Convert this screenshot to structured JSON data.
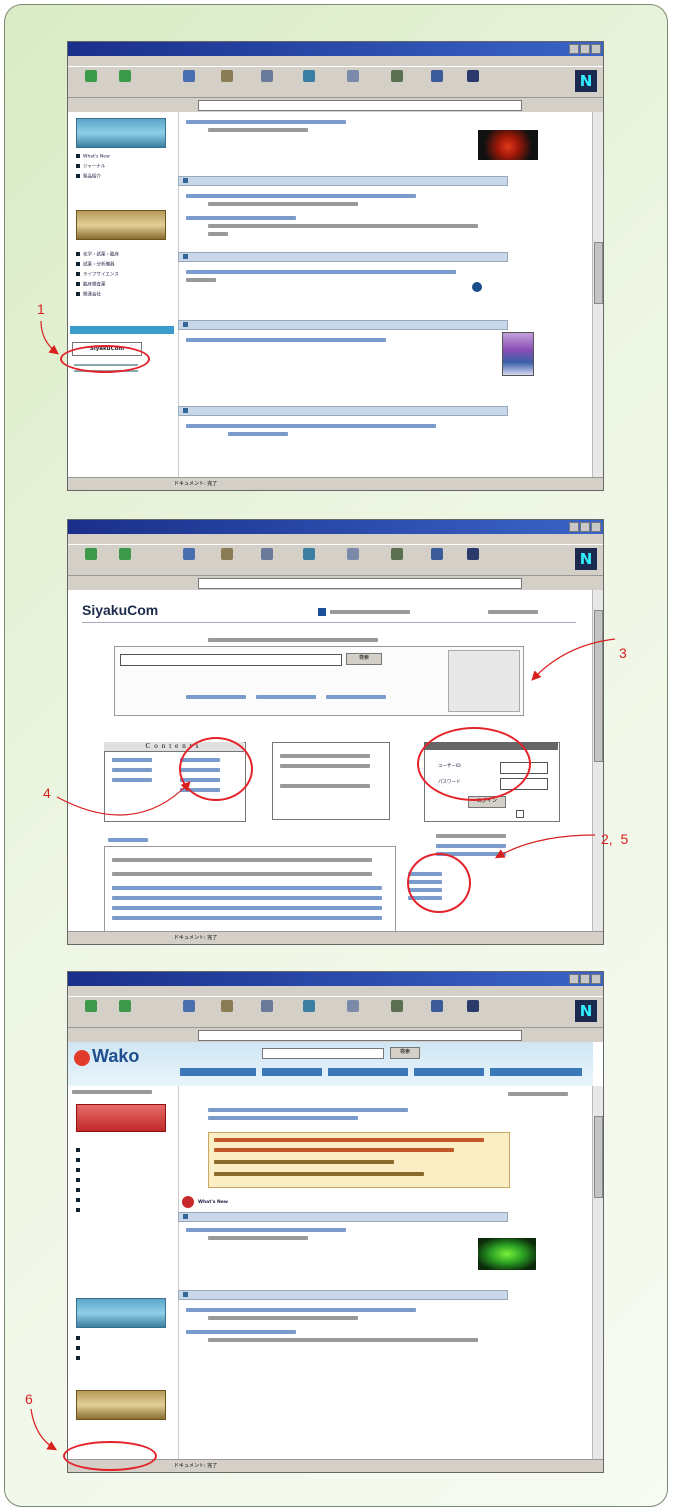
{
  "callouts": {
    "c1": "1",
    "c3": "3",
    "c4": "4",
    "c25": "2,  5",
    "c6": "6"
  },
  "shot1": {
    "status_text": "ドキュメント: 完了",
    "side_menu_1": [
      "What's New",
      "ジャーナル",
      "製品紹介"
    ],
    "side_menu_2": [
      "化学・試薬・臨床",
      "試薬・分析機器",
      "ライフサイエンス",
      "臨床検査薬",
      "関連会社"
    ],
    "highlighted_item": "SiyakuCom"
  },
  "shot2": {
    "logo": "SiyakuCom",
    "status_text": "ドキュメント: 完了",
    "search_button": "検索",
    "contents_title": "Contents",
    "login_button": "ログイン",
    "userid_label": "ユーザーID",
    "password_label": "パスワード"
  },
  "shot3": {
    "logo": "Wako",
    "search_button": "検索",
    "news_label": "What's New",
    "status_text": "ドキュメント: 完了"
  },
  "colors": {
    "callout": "#d8201f",
    "accent": "#e4222a"
  }
}
